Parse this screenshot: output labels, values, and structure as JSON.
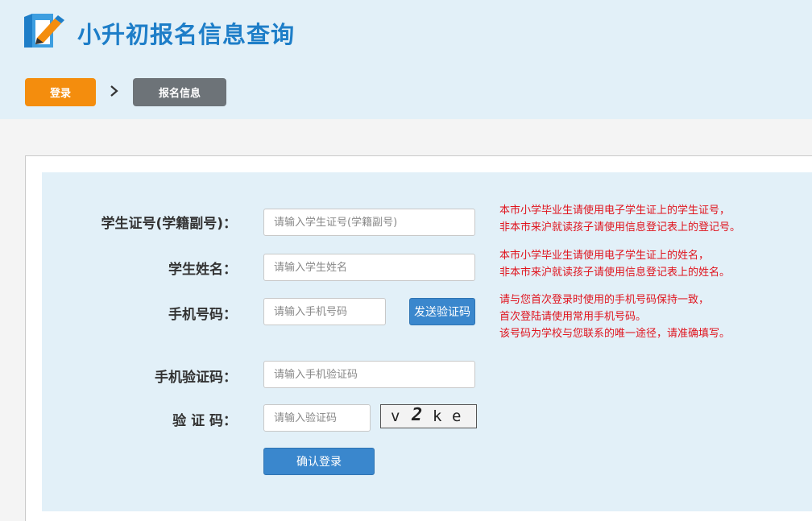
{
  "header": {
    "title": "小升初报名信息查询",
    "logo_icon": "edit-pencil-icon"
  },
  "steps": {
    "login": "登录",
    "separator_icon": "chevron-right-icon",
    "info": "报名信息"
  },
  "form": {
    "student_id": {
      "label": "学生证号(学籍副号)：",
      "placeholder": "请输入学生证号(学籍副号)",
      "value": ""
    },
    "student_name": {
      "label": "学生姓名：",
      "placeholder": "请输入学生姓名",
      "value": ""
    },
    "phone": {
      "label": "手机号码：",
      "placeholder": "请输入手机号码",
      "value": "",
      "send_code_label": "发送验证码"
    },
    "sms_code": {
      "label": "手机验证码：",
      "placeholder": "请输入手机验证码",
      "value": ""
    },
    "captcha": {
      "label": "验 证 码：",
      "placeholder": "请输入验证码",
      "value": "",
      "chars": [
        "v",
        "2",
        "k",
        "e"
      ]
    },
    "submit_label": "确认登录"
  },
  "hints": {
    "student_id": [
      "本市小学毕业生请使用电子学生证上的学生证号，",
      "非本市来沪就读孩子请使用信息登记表上的登记号。"
    ],
    "student_name": [
      "本市小学毕业生请使用电子学生证上的姓名，",
      "非本市来沪就读孩子请使用信息登记表上的姓名。"
    ],
    "phone": [
      "请与您首次登录时使用的手机号码保持一致，",
      "首次登陆请使用常用手机号码。",
      "该号码为学校与您联系的唯一途径，请准确填写。"
    ]
  },
  "colors": {
    "brand_blue": "#1e7ec8",
    "header_bg": "#e2f0f8",
    "step_active": "#f48d0d",
    "step_inactive": "#6d7378",
    "button_blue": "#3a87cd",
    "hint_red": "#e0141e"
  }
}
